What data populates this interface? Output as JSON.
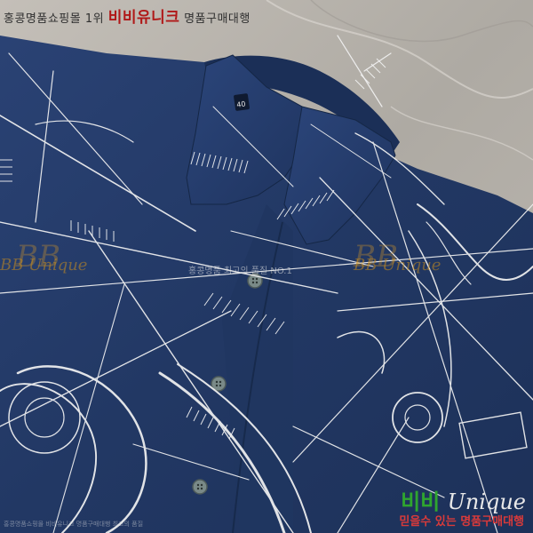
{
  "watermarks": {
    "top_left_prefix": "홍콩명품쇼핑몰 1위",
    "top_left_brand": "비비유니크",
    "top_left_suffix": "명품구매대행",
    "middle_left": "BB Unique",
    "middle_center": "홍콩명품 최고의 품질 NO.1",
    "middle_right": "BB Unique",
    "bottom_right_logo_a": "비비",
    "bottom_right_logo_b": "Unique",
    "bottom_right_tagline": "믿을수 있는 명품구매대행",
    "bottom_left": "홍콩명품쇼핑몰 비비유니크 명품구매대행 최고의 품질"
  },
  "label": {
    "collar_tag": "40"
  },
  "colors": {
    "background_marble": "#b9b4ad",
    "shirt_navy": "#243a66",
    "print_white": "#f2f2f2",
    "button": "#7a8a88"
  }
}
